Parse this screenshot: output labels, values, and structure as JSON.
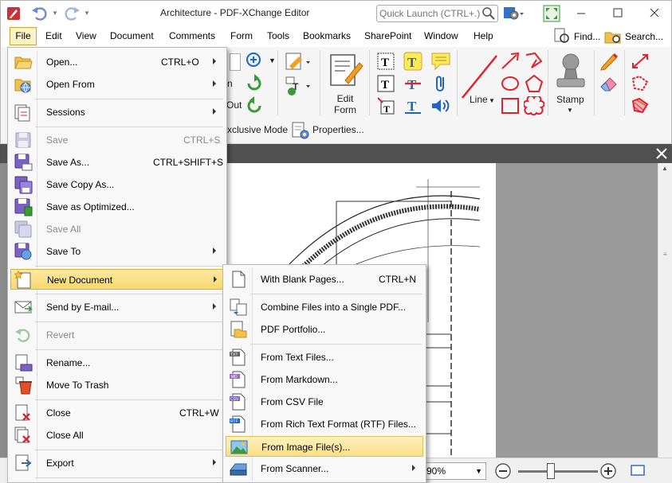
{
  "window": {
    "title": "Architecture - PDF-XChange Editor",
    "quick_launch_placeholder": "Quick Launch (CTRL+.)"
  },
  "menubar": {
    "items": [
      "File",
      "Edit",
      "View",
      "Document",
      "Comments",
      "Form",
      "Tools",
      "Bookmarks",
      "SharePoint",
      "Window",
      "Help"
    ],
    "find_label": "Find...",
    "search_label": "Search..."
  },
  "ribbon": {
    "partial_labels": [
      "n",
      "Out"
    ],
    "edit_form_label": "Edit\nForm",
    "line_label": "Line",
    "stamp_label": "Stamp",
    "exclusive_mode_label": "xclusive Mode",
    "properties_label": "Properties..."
  },
  "file_menu": {
    "items": [
      {
        "label": "Open...",
        "shortcut": "CTRL+O",
        "submenu": true,
        "enabled": true,
        "icon": "open-folder-icon"
      },
      {
        "label": "Open From",
        "shortcut": "",
        "submenu": true,
        "enabled": true,
        "icon": "open-from-icon"
      },
      {
        "label": "Sessions",
        "shortcut": "",
        "submenu": true,
        "enabled": true,
        "icon": "sessions-icon"
      },
      {
        "label": "Save",
        "shortcut": "CTRL+S",
        "submenu": false,
        "enabled": false,
        "icon": "save-icon"
      },
      {
        "label": "Save As...",
        "shortcut": "CTRL+SHIFT+S",
        "submenu": false,
        "enabled": true,
        "icon": "save-as-icon"
      },
      {
        "label": "Save Copy As...",
        "shortcut": "",
        "submenu": false,
        "enabled": true,
        "icon": "save-copy-icon"
      },
      {
        "label": "Save as Optimized...",
        "shortcut": "",
        "submenu": false,
        "enabled": true,
        "icon": "save-optimized-icon"
      },
      {
        "label": "Save All",
        "shortcut": "",
        "submenu": false,
        "enabled": false,
        "icon": "save-all-icon"
      },
      {
        "label": "Save To",
        "shortcut": "",
        "submenu": true,
        "enabled": true,
        "icon": "save-to-icon"
      },
      {
        "label": "New Document",
        "shortcut": "",
        "submenu": true,
        "enabled": true,
        "icon": "new-document-icon"
      },
      {
        "label": "Send by E-mail...",
        "shortcut": "",
        "submenu": true,
        "enabled": true,
        "icon": "email-icon"
      },
      {
        "label": "Revert",
        "shortcut": "",
        "submenu": false,
        "enabled": false,
        "icon": "revert-icon"
      },
      {
        "label": "Rename...",
        "shortcut": "",
        "submenu": false,
        "enabled": true,
        "icon": "rename-icon"
      },
      {
        "label": "Move To Trash",
        "shortcut": "",
        "submenu": false,
        "enabled": true,
        "icon": "trash-icon"
      },
      {
        "label": "Close",
        "shortcut": "CTRL+W",
        "submenu": false,
        "enabled": true,
        "icon": "close-doc-icon"
      },
      {
        "label": "Close All",
        "shortcut": "",
        "submenu": false,
        "enabled": true,
        "icon": "close-all-icon"
      },
      {
        "label": "Export",
        "shortcut": "",
        "submenu": true,
        "enabled": true,
        "icon": "export-icon"
      }
    ]
  },
  "new_document_menu": {
    "items": [
      {
        "label": "With Blank Pages...",
        "shortcut": "CTRL+N",
        "submenu": false,
        "icon": "blank-page-icon"
      },
      {
        "label": "Combine Files into a Single PDF...",
        "shortcut": "",
        "submenu": false,
        "icon": "combine-files-icon"
      },
      {
        "label": "PDF Portfolio...",
        "shortcut": "",
        "submenu": false,
        "icon": "portfolio-icon"
      },
      {
        "label": "From Text Files...",
        "shortcut": "",
        "submenu": false,
        "icon": "txt-file-icon"
      },
      {
        "label": "From Markdown...",
        "shortcut": "",
        "submenu": false,
        "icon": "md-file-icon"
      },
      {
        "label": "From CSV File",
        "shortcut": "",
        "submenu": false,
        "icon": "csv-file-icon"
      },
      {
        "label": "From Rich Text Format (RTF) Files...",
        "shortcut": "",
        "submenu": false,
        "icon": "rtf-file-icon"
      },
      {
        "label": "From Image File(s)...",
        "shortcut": "",
        "submenu": false,
        "icon": "image-file-icon"
      },
      {
        "label": "From Scanner...",
        "shortcut": "",
        "submenu": true,
        "icon": "scanner-icon"
      }
    ]
  },
  "statusbar": {
    "zoom_value": "90%"
  },
  "colors": {
    "accent": "#c9303a",
    "highlight": "#fbdf86",
    "icon_blue": "#1f63c6",
    "icon_green": "#3a9a3a"
  }
}
